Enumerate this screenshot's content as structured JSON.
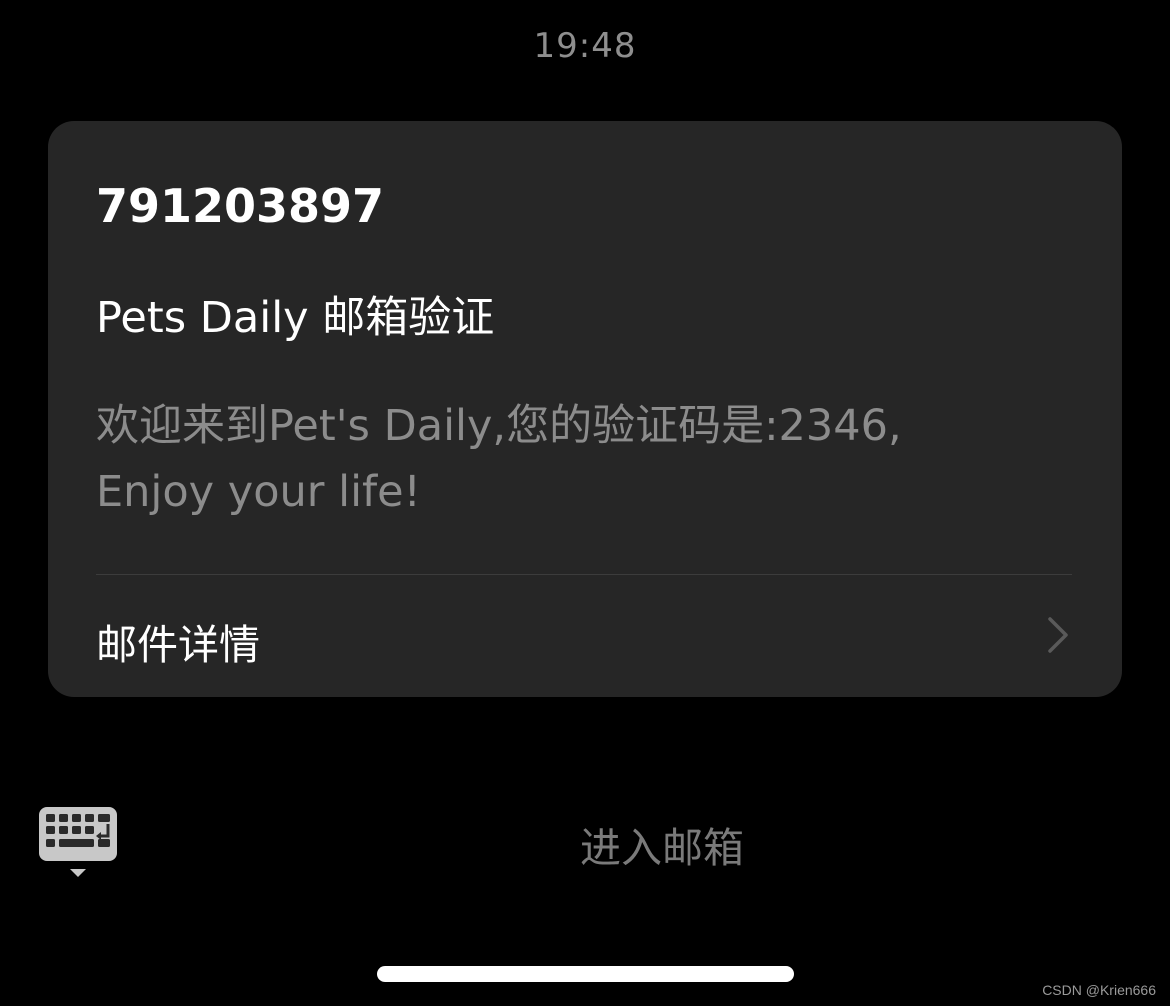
{
  "status_bar": {
    "time": "19:48"
  },
  "notification": {
    "sender": "791203897",
    "subject": "Pets Daily 邮箱验证",
    "body_line1": "欢迎来到Pet's Daily,您的验证码是:2346,",
    "body_line2": "Enjoy your life!",
    "details_label": "邮件详情"
  },
  "actions": {
    "enter_mailbox_label": "进入邮箱",
    "keyboard_icon": "keyboard-icon"
  },
  "watermark": "CSDN @Krien666",
  "colors": {
    "background": "#000000",
    "card": "#262626",
    "primary_text": "#ffffff",
    "secondary_text": "#8c8c8c"
  }
}
